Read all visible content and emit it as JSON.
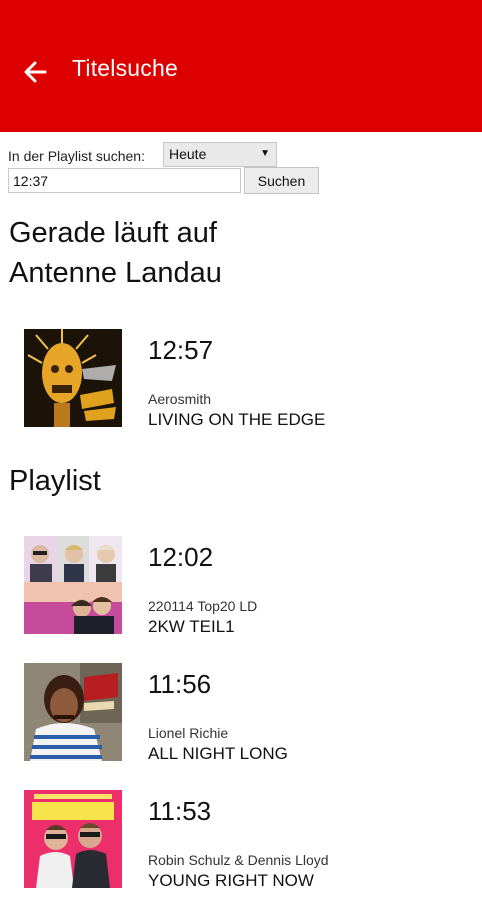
{
  "appbar": {
    "title": "Titelsuche",
    "color": "#dc0000"
  },
  "search": {
    "label": "In der Playlist suchen:",
    "day_selected": "Heute",
    "time_value": "12:37",
    "button_label": "Suchen"
  },
  "now_playing": {
    "heading": "Gerade läuft auf Antenne Landau",
    "track": {
      "time": "12:57",
      "artist": "Aerosmith",
      "title": "LIVING ON THE EDGE"
    }
  },
  "playlist": {
    "heading": "Playlist",
    "items": [
      {
        "time": "12:02",
        "artist": "220114 Top20 LD",
        "title": "2KW TEIL1"
      },
      {
        "time": "11:56",
        "artist": "Lionel Richie",
        "title": "ALL NIGHT LONG"
      },
      {
        "time": "11:53",
        "artist": "Robin Schulz & Dennis Lloyd",
        "title": "YOUNG RIGHT NOW"
      }
    ]
  }
}
